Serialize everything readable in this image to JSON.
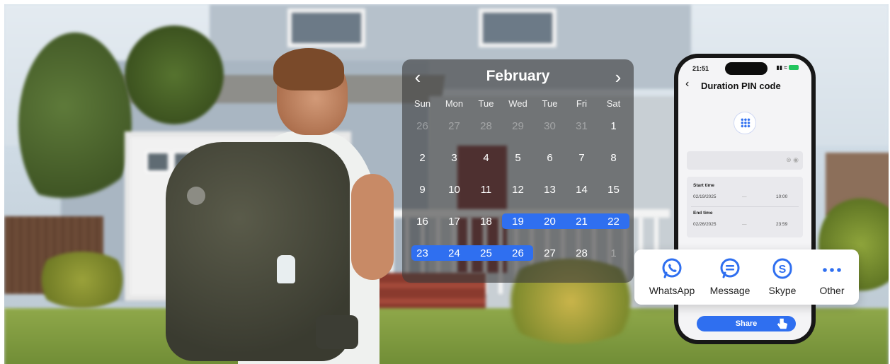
{
  "calendar": {
    "month": "February",
    "weekdays": [
      "Sun",
      "Mon",
      "Tue",
      "Wed",
      "Tue",
      "Fri",
      "Sat"
    ],
    "weeks": [
      [
        "26",
        "27",
        "28",
        "29",
        "30",
        "31",
        "1"
      ],
      [
        "2",
        "3",
        "4",
        "5",
        "6",
        "7",
        "8"
      ],
      [
        "9",
        "10",
        "11",
        "12",
        "13",
        "14",
        "15"
      ],
      [
        "16",
        "17",
        "18",
        "19",
        "20",
        "21",
        "22"
      ],
      [
        "23",
        "24",
        "25",
        "26",
        "27",
        "28",
        "1"
      ]
    ],
    "highlight_color": "#2f6ff0"
  },
  "phone": {
    "status_time": "21:51",
    "title": "Duration PIN code",
    "start_label": "Start time",
    "start_date": "02/19/2025",
    "start_time": "10:00",
    "end_label": "End time",
    "end_date": "02/26/2025",
    "end_time": "23:59",
    "separator": "—",
    "share_label": "Share"
  },
  "share_options": [
    {
      "label": "WhatsApp",
      "icon": "whatsapp-icon"
    },
    {
      "label": "Message",
      "icon": "message-icon"
    },
    {
      "label": "Skype",
      "icon": "skype-icon"
    },
    {
      "label": "Other",
      "icon": "more-icon"
    }
  ],
  "colors": {
    "accent": "#2f6ff0"
  }
}
